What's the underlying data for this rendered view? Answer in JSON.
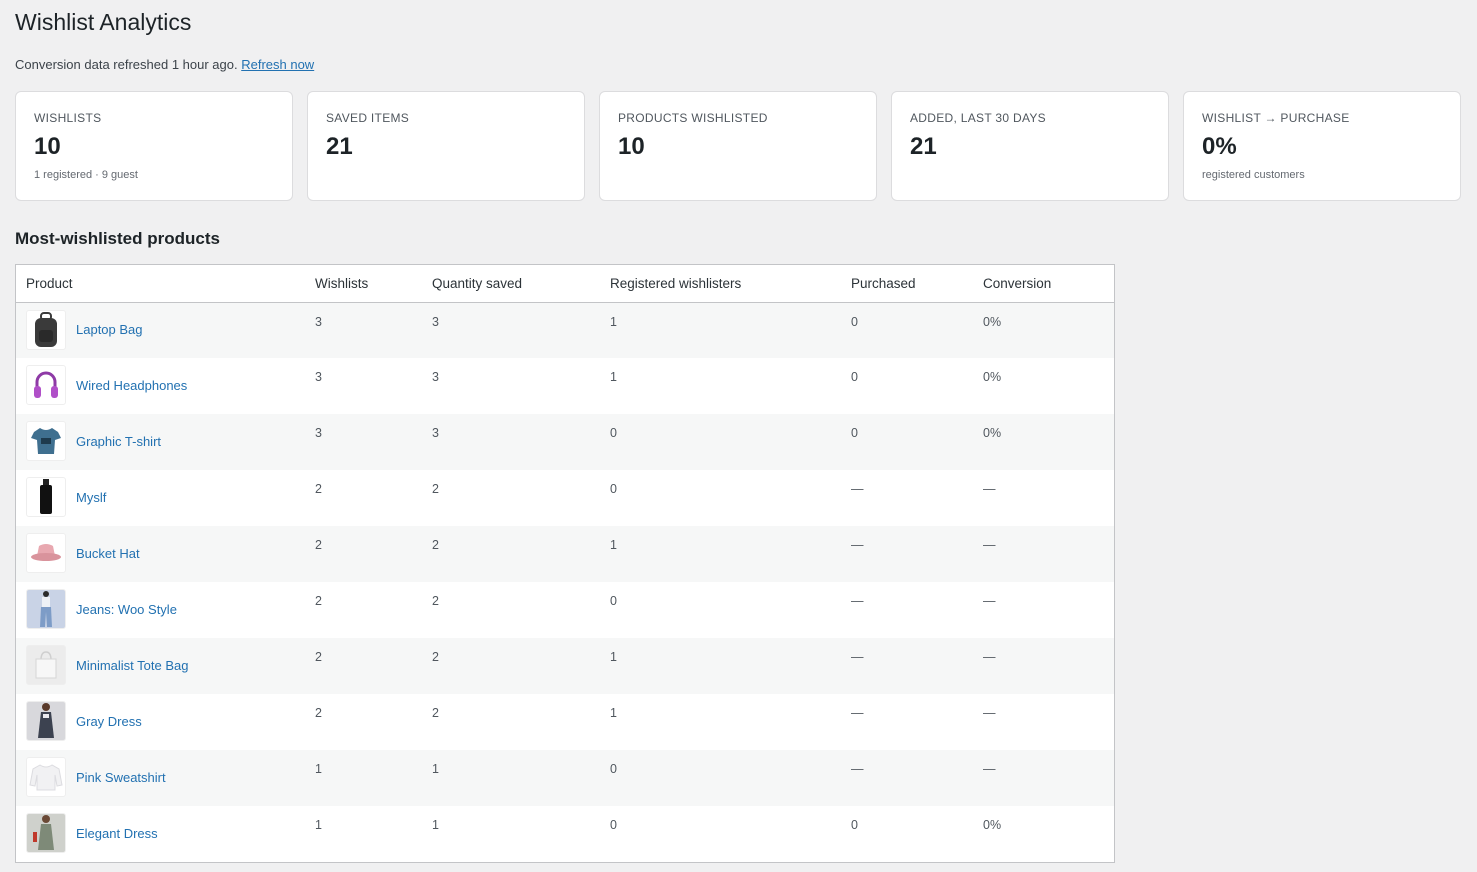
{
  "page": {
    "title": "Wishlist Analytics",
    "refresh_text": "Conversion data refreshed 1 hour ago.",
    "refresh_link": "Refresh now"
  },
  "cards": [
    {
      "label": "Wishlists",
      "value": "10",
      "sub": "1 registered · 9 guest"
    },
    {
      "label": "Saved items",
      "value": "21",
      "sub": ""
    },
    {
      "label": "Products wishlisted",
      "value": "10",
      "sub": ""
    },
    {
      "label": "Added, last 30 days",
      "value": "21",
      "sub": ""
    },
    {
      "label": "Wishlist → Purchase",
      "value": "0%",
      "sub": "registered customers"
    }
  ],
  "section_title": "Most-wishlisted products",
  "table": {
    "headers": [
      "Product",
      "Wishlists",
      "Quantity saved",
      "Registered wishlisters",
      "Purchased",
      "Conversion"
    ],
    "rows": [
      {
        "product": "Laptop Bag",
        "icon": "backpack-icon",
        "wishlists": "3",
        "qty": "3",
        "registered": "1",
        "purchased": "0",
        "conversion": "0%"
      },
      {
        "product": "Wired Headphones",
        "icon": "headphones-icon",
        "wishlists": "3",
        "qty": "3",
        "registered": "1",
        "purchased": "0",
        "conversion": "0%"
      },
      {
        "product": "Graphic T-shirt",
        "icon": "tshirt-icon",
        "wishlists": "3",
        "qty": "3",
        "registered": "0",
        "purchased": "0",
        "conversion": "0%"
      },
      {
        "product": "Myslf",
        "icon": "perfume-bottle-icon",
        "wishlists": "2",
        "qty": "2",
        "registered": "0",
        "purchased": "—",
        "conversion": "—"
      },
      {
        "product": "Bucket Hat",
        "icon": "hat-icon",
        "wishlists": "2",
        "qty": "2",
        "registered": "1",
        "purchased": "—",
        "conversion": "—"
      },
      {
        "product": "Jeans: Woo Style",
        "icon": "jeans-icon",
        "wishlists": "2",
        "qty": "2",
        "registered": "0",
        "purchased": "—",
        "conversion": "—"
      },
      {
        "product": "Minimalist Tote Bag",
        "icon": "tote-bag-icon",
        "wishlists": "2",
        "qty": "2",
        "registered": "1",
        "purchased": "—",
        "conversion": "—"
      },
      {
        "product": "Gray Dress",
        "icon": "dress-icon",
        "wishlists": "2",
        "qty": "2",
        "registered": "1",
        "purchased": "—",
        "conversion": "—"
      },
      {
        "product": "Pink Sweatshirt",
        "icon": "sweatshirt-icon",
        "wishlists": "1",
        "qty": "1",
        "registered": "0",
        "purchased": "—",
        "conversion": "—"
      },
      {
        "product": "Elegant Dress",
        "icon": "dress-icon",
        "wishlists": "1",
        "qty": "1",
        "registered": "0",
        "purchased": "0",
        "conversion": "0%"
      }
    ]
  },
  "colors": {
    "background": "#f0f0f1",
    "link": "#2271b1",
    "card_border": "#dcdcde",
    "table_border": "#c3c4c7"
  }
}
